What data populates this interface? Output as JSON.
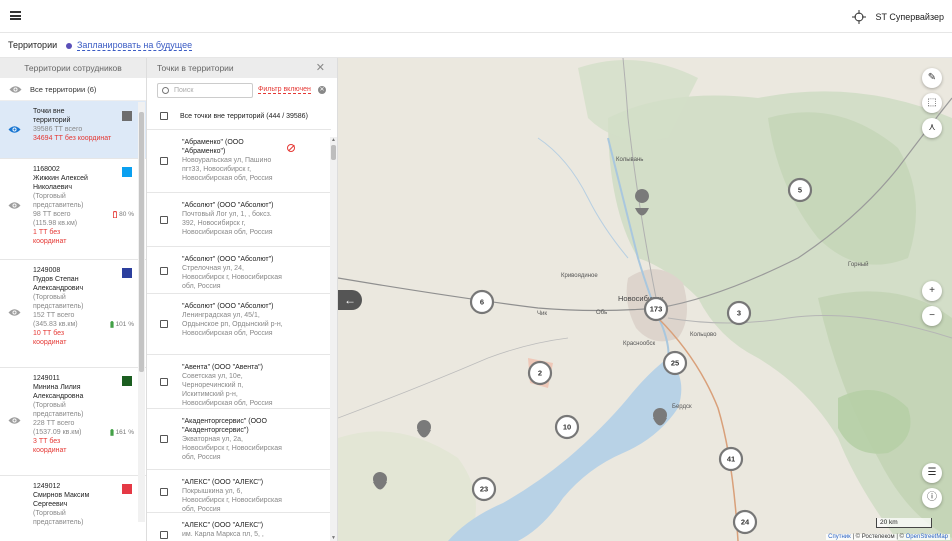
{
  "header": {
    "app_name": "ST Супервайзер"
  },
  "subbar": {
    "title": "Территории",
    "plan_link": "Запланировать на будущее"
  },
  "left_panel": {
    "title": "Территории сотрудников",
    "all_label": "Все территории (6)",
    "items": [
      {
        "name": "Точки вне территорий",
        "total": "39586 ТТ всего",
        "no_coords": "34694 ТТ без координат",
        "swatch": "#6d6d6d",
        "selected": true
      },
      {
        "code": "1168002",
        "name": "Жижкин Алексей Николаевич",
        "role": "(Торговый представитель)",
        "total": "98 ТТ всего",
        "area": "(115.98 кв.км)",
        "pct": "80 %",
        "pct_color": "#e53935",
        "no_coords": "1 ТТ без координат",
        "swatch": "#0aa0f0"
      },
      {
        "code": "1249008",
        "name": "Пудов Степан Александрович",
        "role": "(Торговый представитель)",
        "total": "152 ТТ всего",
        "area": "(345.83 кв.км)",
        "pct": "101 %",
        "pct_color": "#43a047",
        "no_coords": "10 ТТ без координат",
        "swatch": "#2c3f9e"
      },
      {
        "code": "1249011",
        "name": "Минина Лилия Александровна",
        "role": "(Торговый представитель)",
        "total": "228 ТТ всего",
        "area": "(1537.09 кв.км)",
        "pct": "161 %",
        "pct_color": "#43a047",
        "no_coords": "3 ТТ без координат",
        "swatch": "#1b5e20"
      },
      {
        "code": "1249012",
        "name": "Смирнов Максим Сергеевич",
        "role": "(Торговый представитель)",
        "swatch": "#e53945"
      }
    ]
  },
  "mid_panel": {
    "title": "Точки в территории",
    "search_placeholder": "Поиск",
    "filter_label": "Фильтр включен",
    "all_label": "Все точки вне территорий (444 / 39586)",
    "items": [
      {
        "name": "\"Абраменко\" (ООО \"Абраменко\")",
        "address": "Новоуральская ул, Пашино пгт33, Новосибирск г, Новосибирская обл, Россия",
        "no_location": true
      },
      {
        "name": "\"Абсолют\" (ООО \"Абсолют\")",
        "address": "Почтовый Лог ул, 1, , боксз. 392, Новосибирск г, Новосибирская обл, Россия"
      },
      {
        "name": "\"Абсолют\" (ООО \"Абсолют\")",
        "address": "Стрелочная ул, 24, Новосибирск г, Новосибирская обл, Россия"
      },
      {
        "name": "\"Абсолют\" (ООО \"Абсолют\")",
        "address": "Ленинградская ул, 45/1, Ордынское рп, Ордынский р-н, Новосибирская обл, Россия"
      },
      {
        "name": "\"Авента\" (ООО \"Авента\")",
        "address": "Советская ул, 10е, Черноречинский п, Искитимский р-н, Новосибирская обл, Россия"
      },
      {
        "name": "\"Акаденторгсервис\" (ООО \"Акаденторгсервис\")",
        "address": "Экваторная ул, 2а, Новосибирск г, Новосибирская обл, Россия"
      },
      {
        "name": "\"АЛЕКС\" (ООО \"АЛЕКС\")",
        "address": "Покрышкина ул, 6, Новосибирск г, Новосибирская обл, Россия"
      },
      {
        "name": "\"АЛЕКС\" (ООО \"АЛЕКС\")",
        "address": "им. Карла Маркса пл, 5, ,"
      }
    ]
  },
  "map": {
    "places": [
      "Колывань",
      "Кривоядиное",
      "Новосибирск",
      "Обь",
      "Краснообск",
      "Кольцово",
      "Бердск",
      "Чик",
      "Горный"
    ],
    "clusters": [
      {
        "label": "5"
      },
      {
        "label": "6"
      },
      {
        "label": "173"
      },
      {
        "label": "3"
      },
      {
        "label": "25"
      },
      {
        "label": "2"
      },
      {
        "label": "10"
      },
      {
        "label": "41"
      },
      {
        "label": "23"
      },
      {
        "label": "24"
      }
    ],
    "scale_label": "20 km",
    "attribution_parts": [
      "Спутник",
      " | © Ростелеком | © ",
      "OpenStreetMap"
    ]
  }
}
